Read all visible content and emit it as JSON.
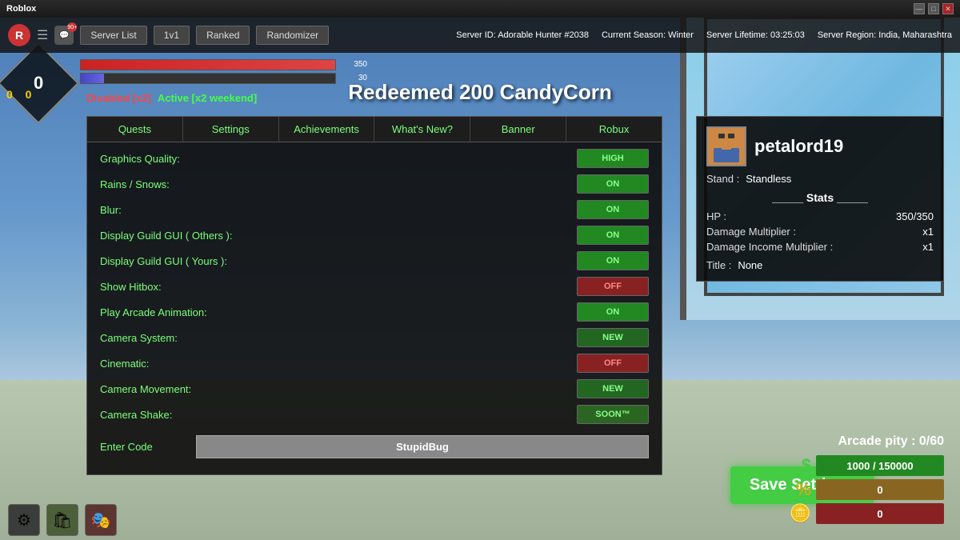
{
  "topbar": {
    "title": "Roblox",
    "controls": [
      "—",
      "□",
      "✕"
    ]
  },
  "navbar": {
    "logo": "R",
    "chat_count": "90+",
    "buttons": [
      "Server List",
      "1v1",
      "Ranked",
      "Randomizer"
    ],
    "server_id_label": "Server ID:",
    "server_id": "Adorable Hunter #2038",
    "season_label": "Current Season:",
    "season": "Winter",
    "lifetime_label": "Server Lifetime:",
    "lifetime": "03:25:03",
    "region_label": "Server Region:",
    "region": "India, Maharashtra"
  },
  "hud": {
    "score1": "0",
    "score2": "0",
    "score3": "0",
    "health_val": "350",
    "health_max": "350",
    "stamina_val": "30"
  },
  "notification": {
    "text": "Redeemed 200 CandyCorn"
  },
  "status": {
    "disabled": "Disabled [x2]",
    "active": "Active [x2 weekend]"
  },
  "tabs": [
    {
      "label": "Quests"
    },
    {
      "label": "Settings"
    },
    {
      "label": "Achievements"
    },
    {
      "label": "What's New?"
    },
    {
      "label": "Banner"
    },
    {
      "label": "Robux"
    }
  ],
  "settings": [
    {
      "label": "Graphics Quality:",
      "btn": "HIGH",
      "style": "btn-high"
    },
    {
      "label": "Rains / Snows:",
      "btn": "ON",
      "style": "btn-on"
    },
    {
      "label": "Blur:",
      "btn": "ON",
      "style": "btn-on"
    },
    {
      "label": "Display Guild GUI ( Others ):",
      "btn": "ON",
      "style": "btn-on"
    },
    {
      "label": "Display Guild GUI ( Yours ):",
      "btn": "ON",
      "style": "btn-on"
    },
    {
      "label": "Show Hitbox:",
      "btn": "OFF",
      "style": "btn-off"
    },
    {
      "label": "Play Arcade Animation:",
      "btn": "ON",
      "style": "btn-on"
    },
    {
      "label": "Camera System:",
      "btn": "NEW",
      "style": "btn-new"
    },
    {
      "label": "Cinematic:",
      "btn": "OFF",
      "style": "btn-off"
    },
    {
      "label": "Camera Movement:",
      "btn": "NEW",
      "style": "btn-new"
    },
    {
      "label": "Camera Shake:",
      "btn": "SOON™",
      "style": "btn-soon"
    }
  ],
  "entercode": {
    "label": "Enter Code",
    "placeholder": "StupidBug"
  },
  "save_btn": "Save Settings",
  "player": {
    "name": "petalord19",
    "stand_label": "Stand :",
    "stand_value": "Standless",
    "stats_title": "_____ Stats _____",
    "hp_label": "HP :",
    "hp_value": "350/350",
    "dmg_label": "Damage Multiplier :",
    "dmg_value": "x1",
    "income_label": "Damage Income Multiplier :",
    "income_value": "x1",
    "title_label": "Title :",
    "title_value": "None"
  },
  "currency": {
    "arcade_pity": "Arcade pity : 0/60",
    "cash_value": "1000 / 150000",
    "percent_value": "0",
    "coins_value": "0"
  },
  "bottom_hud": {
    "actions": [
      "⚙",
      "🛍",
      "🎭"
    ]
  }
}
